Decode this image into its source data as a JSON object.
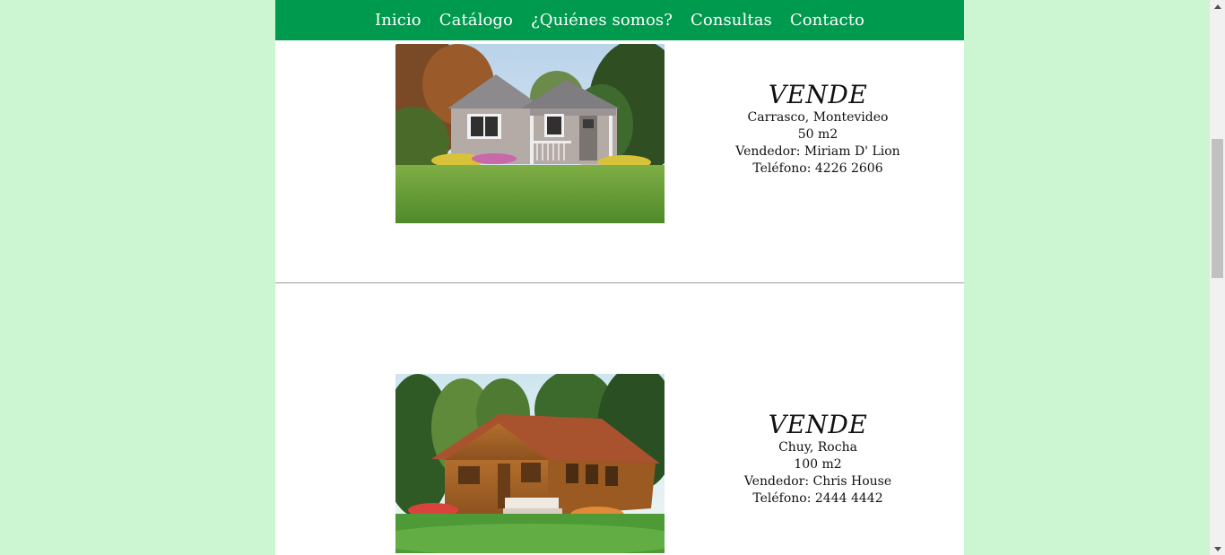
{
  "nav": {
    "items": [
      {
        "label": "Inicio"
      },
      {
        "label": "Catálogo"
      },
      {
        "label": "¿Quiénes somos?"
      },
      {
        "label": "Consultas"
      },
      {
        "label": "Contacto"
      }
    ]
  },
  "listings": [
    {
      "title": "VENDE",
      "location": "Carrasco, Montevideo",
      "area": "50 m2",
      "seller": "Vendedor: Miriam D' Lion",
      "phone": "Teléfono: 4226 2606"
    },
    {
      "title": "VENDE",
      "location": "Chuy, Rocha",
      "area": "100 m2",
      "seller": "Vendedor: Chris House",
      "phone": "Teléfono: 2444 4442"
    }
  ],
  "colors": {
    "nav_background": "#009a4e",
    "side_background": "#ccf5d1",
    "content_background": "#ffffff"
  }
}
